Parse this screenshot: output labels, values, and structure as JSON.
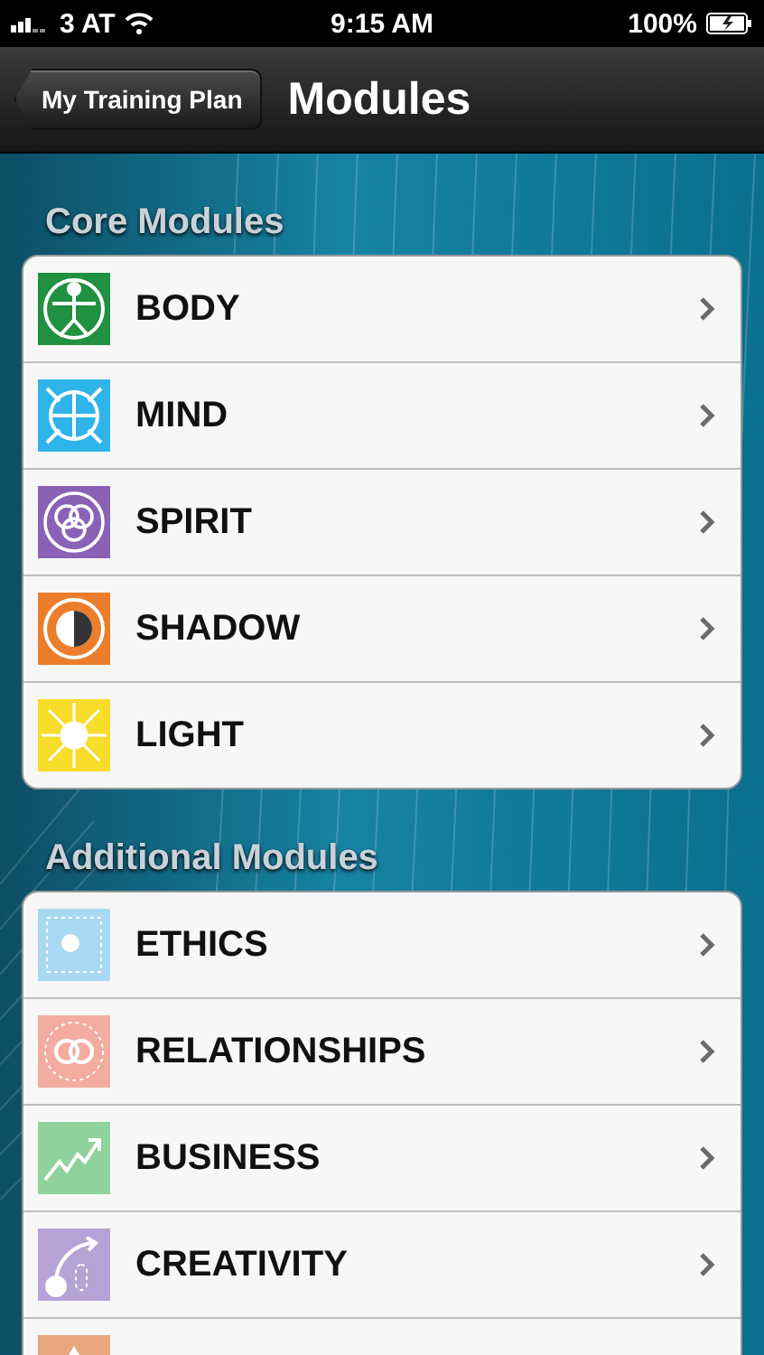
{
  "status_bar": {
    "carrier": "3 AT",
    "time": "9:15 AM",
    "battery": "100%"
  },
  "nav_bar": {
    "back": "My Training Plan",
    "title": "Modules"
  },
  "sections": [
    {
      "title": "Core Modules",
      "items": [
        {
          "label": "BODY",
          "kind": "body",
          "color": "#1f9140"
        },
        {
          "label": "MIND",
          "kind": "mind",
          "color": "#2fb4ea"
        },
        {
          "label": "SPIRIT",
          "kind": "spirit",
          "color": "#8a62b5"
        },
        {
          "label": "SHADOW",
          "kind": "shadow",
          "color": "#ec7d2c"
        },
        {
          "label": "LIGHT",
          "kind": "light",
          "color": "#f7dc2a"
        }
      ]
    },
    {
      "title": "Additional Modules",
      "items": [
        {
          "label": "ETHICS",
          "kind": "ethics",
          "color": "#a9d9f2"
        },
        {
          "label": "RELATIONSHIPS",
          "kind": "relationships",
          "color": "#f3aca0"
        },
        {
          "label": "BUSINESS",
          "kind": "business",
          "color": "#8fd29c"
        },
        {
          "label": "CREATIVITY",
          "kind": "creativity",
          "color": "#b5a3d6"
        },
        {
          "kind": "peak",
          "color": "#e9a77e"
        }
      ]
    }
  ]
}
